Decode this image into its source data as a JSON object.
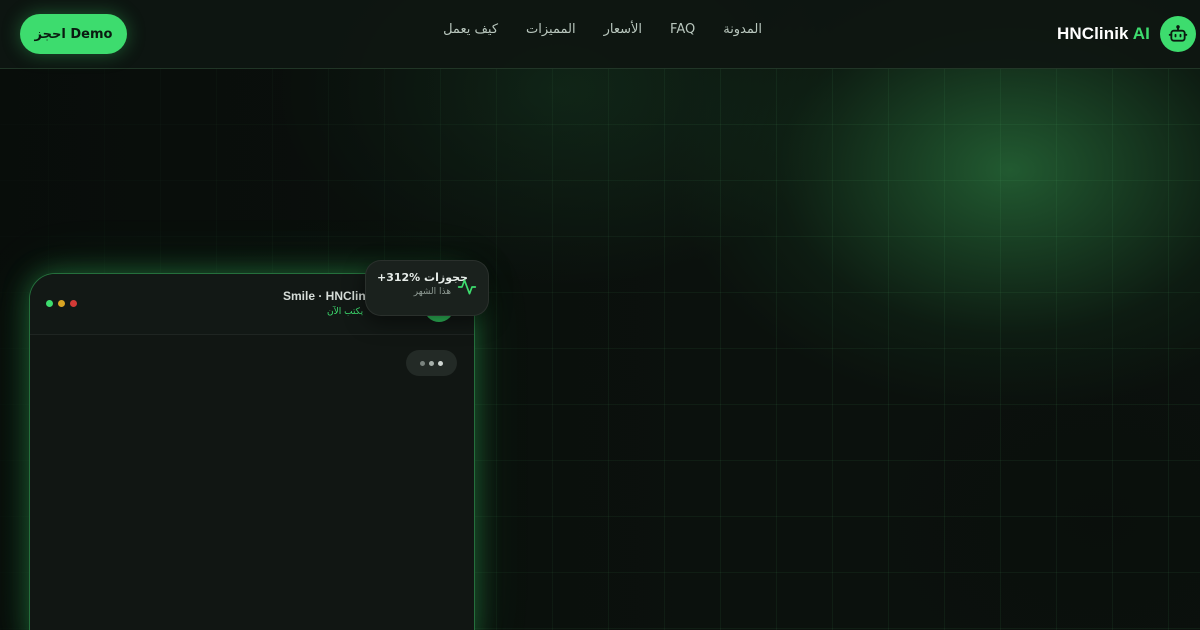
{
  "header": {
    "brand_name": "HNClinik",
    "brand_suffix": "AI",
    "brand_icon": "robot-icon",
    "nav": [
      {
        "label": "كيف يعمل"
      },
      {
        "label": "المميزات"
      },
      {
        "label": "الأسعار"
      },
      {
        "label": "FAQ"
      },
      {
        "label": "المدونة"
      }
    ],
    "cta_label": "احجز Demo"
  },
  "chat": {
    "title": "Smile · HNClinik",
    "status": "يكتب الآن",
    "window_dots": [
      "green",
      "yellow",
      "red"
    ],
    "typing_indicator": "typing-dots-icon"
  },
  "stat": {
    "value": "+312% حجوزات",
    "sub": "هذا الشهر",
    "icon": "activity-icon"
  },
  "colors": {
    "accent": "#3ddc6e",
    "background": "#0b110d",
    "card": "#111613"
  }
}
